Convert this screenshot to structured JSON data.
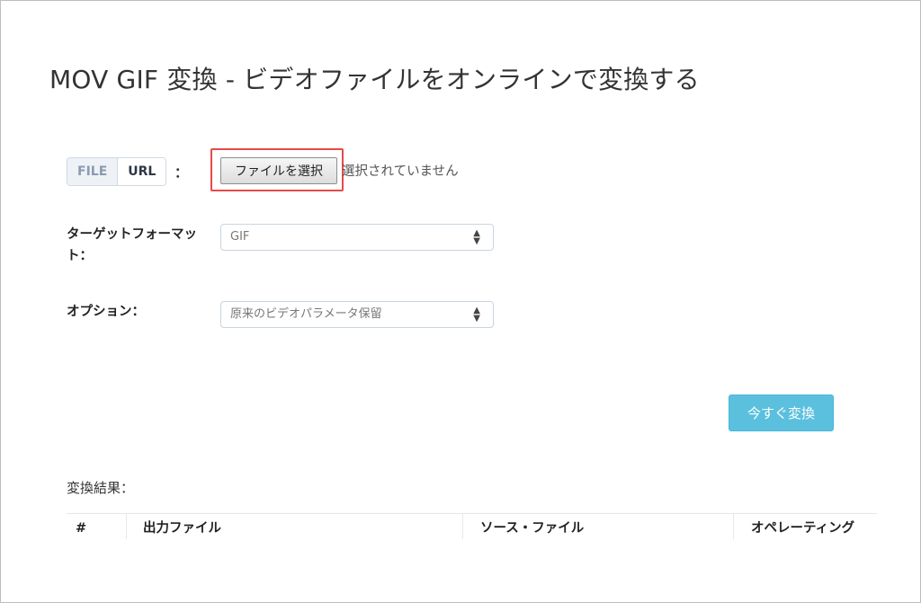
{
  "header": {
    "title": "MOV GIF 変換 - ビデオファイルをオンラインで変換する"
  },
  "source_toggle": {
    "file_label": "FILE",
    "url_label": "URL",
    "colon": "："
  },
  "file_input": {
    "button_label": "ファイルを選択",
    "status": "選択されていません"
  },
  "target_format": {
    "label_line1": "ターゲットフォーマッ",
    "label_line2": "ト：",
    "selected": "GIF"
  },
  "options": {
    "label": "オプション：",
    "selected": "原来のビデオパラメータ保留"
  },
  "actions": {
    "convert_label": "今すぐ変換"
  },
  "results": {
    "label": "変換結果：",
    "columns": [
      "#",
      "出力ファイル",
      "ソース・ファイル",
      "オペレーティング"
    ]
  },
  "colors": {
    "accent": "#5bc0de",
    "highlight": "#e64a4a"
  },
  "icons": {
    "select_arrows": "sort-arrows-icon"
  }
}
